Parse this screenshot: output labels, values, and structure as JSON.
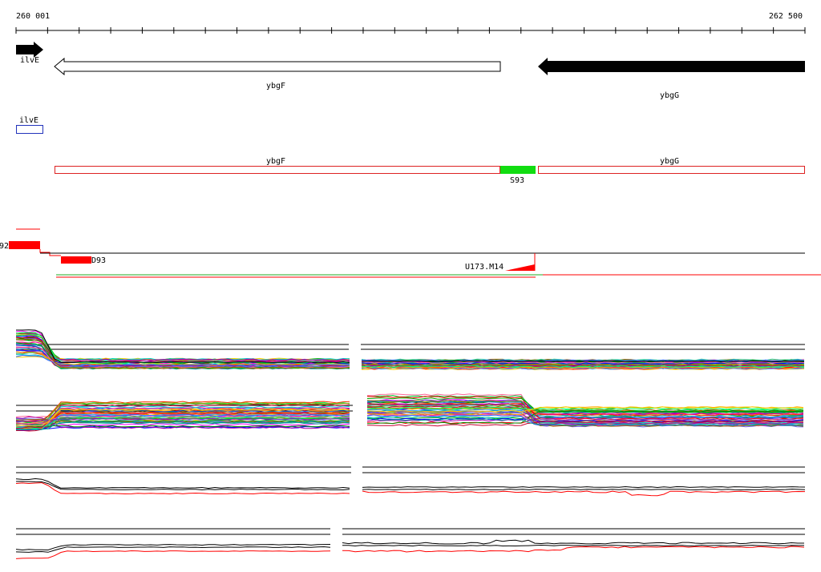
{
  "ruler": {
    "start_label": "260 001",
    "end_label": "262 500"
  },
  "genes": {
    "ilvE": "ilvE",
    "ybgF": "ybgF",
    "ybgG": "ybgG"
  },
  "features": {
    "ilvE_box": "ilvE",
    "ybgF_box": "ybgF",
    "ybgG_box": "ybgG",
    "s_label": "S93"
  },
  "segments": {
    "left_label": "92",
    "d_label": "D93",
    "u_label": "U173.M14"
  },
  "colors": {
    "gene_arrow": "#000000",
    "orf_box": "#dd2222",
    "ilvE_box": "#2233bb",
    "intergenic": "#11dd11",
    "segment": "#ff0000",
    "green_line": "#22aa22"
  }
}
